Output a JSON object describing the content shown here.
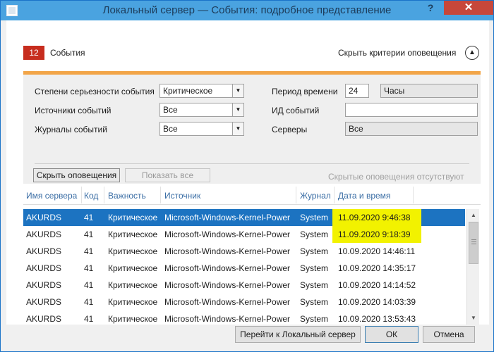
{
  "window": {
    "title": "Локальный сервер — События: подробное представление",
    "help_label": "?",
    "close_label": "✕"
  },
  "header": {
    "event_count": "12",
    "events_label": "События",
    "hide_criteria_label": "Скрыть критерии оповещения",
    "collapse_icon": "chevron-up-icon"
  },
  "criteria": {
    "severity_label": "Степени серьезности события",
    "severity_value": "Критическое",
    "sources_label": "Источники событий",
    "sources_value": "Все",
    "logs_label": "Журналы событий",
    "logs_value": "Все",
    "period_label": "Период времени",
    "period_value": "24",
    "period_unit": "Часы",
    "event_id_label": "ИД событий",
    "event_id_value": "",
    "servers_label": "Серверы",
    "servers_value": "Все",
    "hide_alerts_button": "Скрыть оповещения",
    "show_all_button": "Показать все",
    "no_hidden_alerts": "Скрытые оповещения отсутствуют"
  },
  "table": {
    "columns": [
      "Имя сервера",
      "Код",
      "Важность",
      "Источник",
      "Журнал",
      "Дата и время"
    ],
    "rows": [
      {
        "server": "AKURDS",
        "code": "41",
        "severity": "Критическое",
        "source": "Microsoft-Windows-Kernel-Power",
        "log": "System",
        "datetime": "11.09.2020 9:46:38"
      },
      {
        "server": "AKURDS",
        "code": "41",
        "severity": "Критическое",
        "source": "Microsoft-Windows-Kernel-Power",
        "log": "System",
        "datetime": "11.09.2020 9:18:39"
      },
      {
        "server": "AKURDS",
        "code": "41",
        "severity": "Критическое",
        "source": "Microsoft-Windows-Kernel-Power",
        "log": "System",
        "datetime": "10.09.2020 14:46:11"
      },
      {
        "server": "AKURDS",
        "code": "41",
        "severity": "Критическое",
        "source": "Microsoft-Windows-Kernel-Power",
        "log": "System",
        "datetime": "10.09.2020 14:35:17"
      },
      {
        "server": "AKURDS",
        "code": "41",
        "severity": "Критическое",
        "source": "Microsoft-Windows-Kernel-Power",
        "log": "System",
        "datetime": "10.09.2020 14:14:52"
      },
      {
        "server": "AKURDS",
        "code": "41",
        "severity": "Критическое",
        "source": "Microsoft-Windows-Kernel-Power",
        "log": "System",
        "datetime": "10.09.2020 14:03:39"
      },
      {
        "server": "AKURDS",
        "code": "41",
        "severity": "Критическое",
        "source": "Microsoft-Windows-Kernel-Power",
        "log": "System",
        "datetime": "10.09.2020 13:53:43"
      }
    ]
  },
  "footer": {
    "goto_button": "Перейти к Локальный сервер",
    "ok_button": "ОК",
    "cancel_button": "Отмена"
  },
  "colors": {
    "accent_blue": "#1c73c1",
    "badge_red": "#c72d1e",
    "highlight_yellow": "#f2f200",
    "orange_bar": "#f2a548"
  }
}
